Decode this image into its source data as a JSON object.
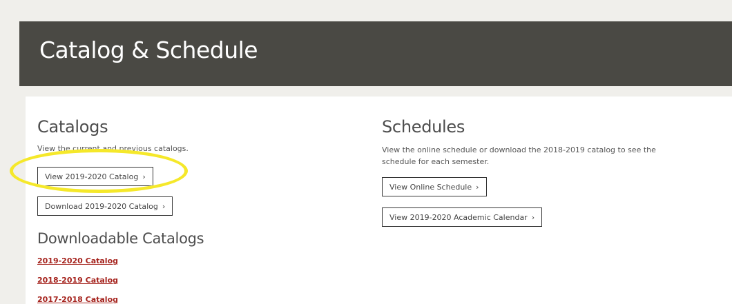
{
  "header": {
    "title": "Catalog & Schedule"
  },
  "catalogs": {
    "title": "Catalogs",
    "description": "View the current and previous catalogs.",
    "view_button": "View 2019-2020 Catalog",
    "download_button": "Download 2019-2020 Catalog",
    "downloadable_title": "Downloadable Catalogs",
    "links": [
      "2019-2020 Catalog",
      "2018-2019 Catalog",
      "2017-2018 Catalog"
    ]
  },
  "schedules": {
    "title": "Schedules",
    "description": "View the online schedule or download the 2018-2019 catalog to see the schedule for each semester.",
    "online_button": "View Online Schedule",
    "calendar_button": "View 2019-2020 Academic Calendar"
  },
  "icons": {
    "chevron": "›"
  },
  "colors": {
    "header_bg": "#4a4944",
    "link_red": "#a5231d",
    "highlight_yellow": "#f5e82a",
    "page_bg": "#f0efeb"
  }
}
